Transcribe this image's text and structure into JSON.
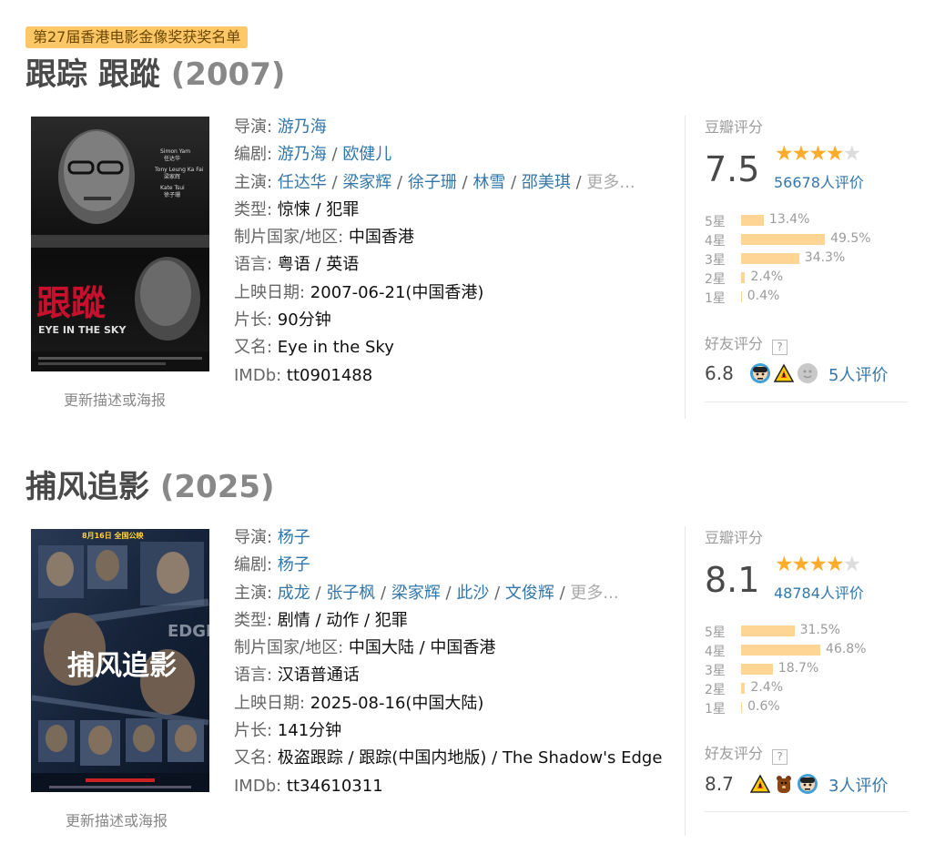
{
  "badge": "第27届香港电影金像奖获奖名单",
  "labels": {
    "director": "导演: ",
    "writer": "编剧: ",
    "cast": "主演: ",
    "genre": "类型: ",
    "country": "制片国家/地区: ",
    "language": "语言: ",
    "release": "上映日期: ",
    "runtime": "片长: ",
    "aka": "又名: ",
    "imdb": "IMDb: ",
    "more": "更多...",
    "rating_header": "豆瓣评分",
    "friends_header": "好友评分",
    "question_mark": "?",
    "update": "更新描述或海报"
  },
  "movies": [
    {
      "title": "跟踪 跟蹤",
      "year": "(2007)",
      "directors": [
        "游乃海"
      ],
      "writers": [
        "游乃海",
        "欧健儿"
      ],
      "cast": [
        "任达华",
        "梁家辉",
        "徐子珊",
        "林雪",
        "邵美琪"
      ],
      "genre": "惊悚 / 犯罪",
      "country": "中国香港",
      "language": "粤语 / 英语",
      "release": "2007-06-21(中国香港)",
      "runtime": "90分钟",
      "aka": "Eye in the Sky",
      "imdb": "tt0901488",
      "score": "7.5",
      "stars": 4,
      "votes": "56678人评价",
      "distribution": [
        {
          "label": "5星",
          "pct": "13.4%",
          "value": 13.4
        },
        {
          "label": "4星",
          "pct": "49.5%",
          "value": 49.5
        },
        {
          "label": "3星",
          "pct": "34.3%",
          "value": 34.3
        },
        {
          "label": "2星",
          "pct": "2.4%",
          "value": 2.4
        },
        {
          "label": "1星",
          "pct": "0.4%",
          "value": 0.4
        }
      ],
      "friends_score": "6.8",
      "friends_avatars": [
        "avatar-face-icon",
        "warning-icon",
        "gray-face-icon"
      ],
      "friends_votes": "5人评价",
      "poster_text": {
        "actor1_en": "Simon Yam",
        "actor1_cn": "任达华",
        "actor2_en": "Tony Leung Ka Fai",
        "actor2_cn": "梁家辉",
        "actor3_en": "Kate Tsui",
        "actor3_cn": "徐子珊",
        "big_title": "跟蹤",
        "en_title": "EYE IN THE SKY"
      }
    },
    {
      "title": "捕风追影",
      "year": "(2025)",
      "directors": [
        "杨子"
      ],
      "writers": [
        "杨子"
      ],
      "cast": [
        "成龙",
        "张子枫",
        "梁家辉",
        "此沙",
        "文俊辉"
      ],
      "genre": "剧情 / 动作 / 犯罪",
      "country": "中国大陆 / 中国香港",
      "language": "汉语普通话",
      "release": "2025-08-16(中国大陆)",
      "runtime": "141分钟",
      "aka": "极盗跟踪 / 跟踪(中国内地版) / The Shadow's Edge",
      "imdb": "tt34610311",
      "score": "8.1",
      "stars": 4,
      "votes": "48784人评价",
      "distribution": [
        {
          "label": "5星",
          "pct": "31.5%",
          "value": 31.5
        },
        {
          "label": "4星",
          "pct": "46.8%",
          "value": 46.8
        },
        {
          "label": "3星",
          "pct": "18.7%",
          "value": 18.7
        },
        {
          "label": "2星",
          "pct": "2.4%",
          "value": 2.4
        },
        {
          "label": "1星",
          "pct": "0.6%",
          "value": 0.6
        }
      ],
      "friends_score": "8.7",
      "friends_avatars": [
        "warning-icon",
        "bear-icon",
        "avatar-face-icon"
      ],
      "friends_votes": "3人评价",
      "poster_text": {
        "top_banner": "8月16日 全国公映",
        "big_title": "捕风追影",
        "edge": "EDGE"
      }
    }
  ],
  "colors": {
    "link": "#3377aa",
    "star_on": "#ffac2d",
    "bar": "#ffd596",
    "badge_bg": "#ffc766"
  }
}
